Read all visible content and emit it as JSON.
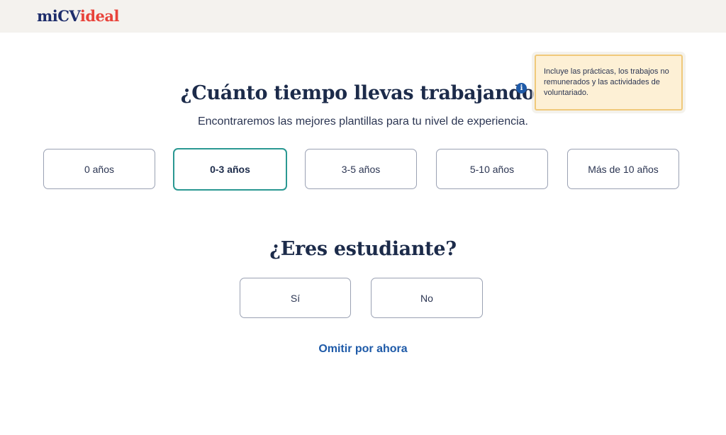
{
  "header": {
    "logo": {
      "part1": "mi",
      "part2": "CV",
      "part3": "ideal"
    }
  },
  "experience": {
    "question": "¿Cuánto tiempo llevas trabajando?",
    "info_icon": "info-icon",
    "tooltip": "Incluye las prácticas, los trabajos no remunerados y las actividades de voluntariado.",
    "subtitle": "Encontraremos las mejores plantillas para tu nivel de experiencia.",
    "options": [
      "0 años",
      "0-3 años",
      "3-5 años",
      "5-10 años",
      "Más de 10 años"
    ],
    "selected": "0-3 años"
  },
  "student": {
    "question": "¿Eres estudiante?",
    "options": [
      "Sí",
      "No"
    ]
  },
  "skip_label": "Omitir por ahora",
  "colors": {
    "brand_blue": "#1d2d6b",
    "brand_red": "#e8433a",
    "selected_border": "#2a9892",
    "link": "#1e5aa8",
    "tooltip_bg": "#fdf0d5"
  }
}
